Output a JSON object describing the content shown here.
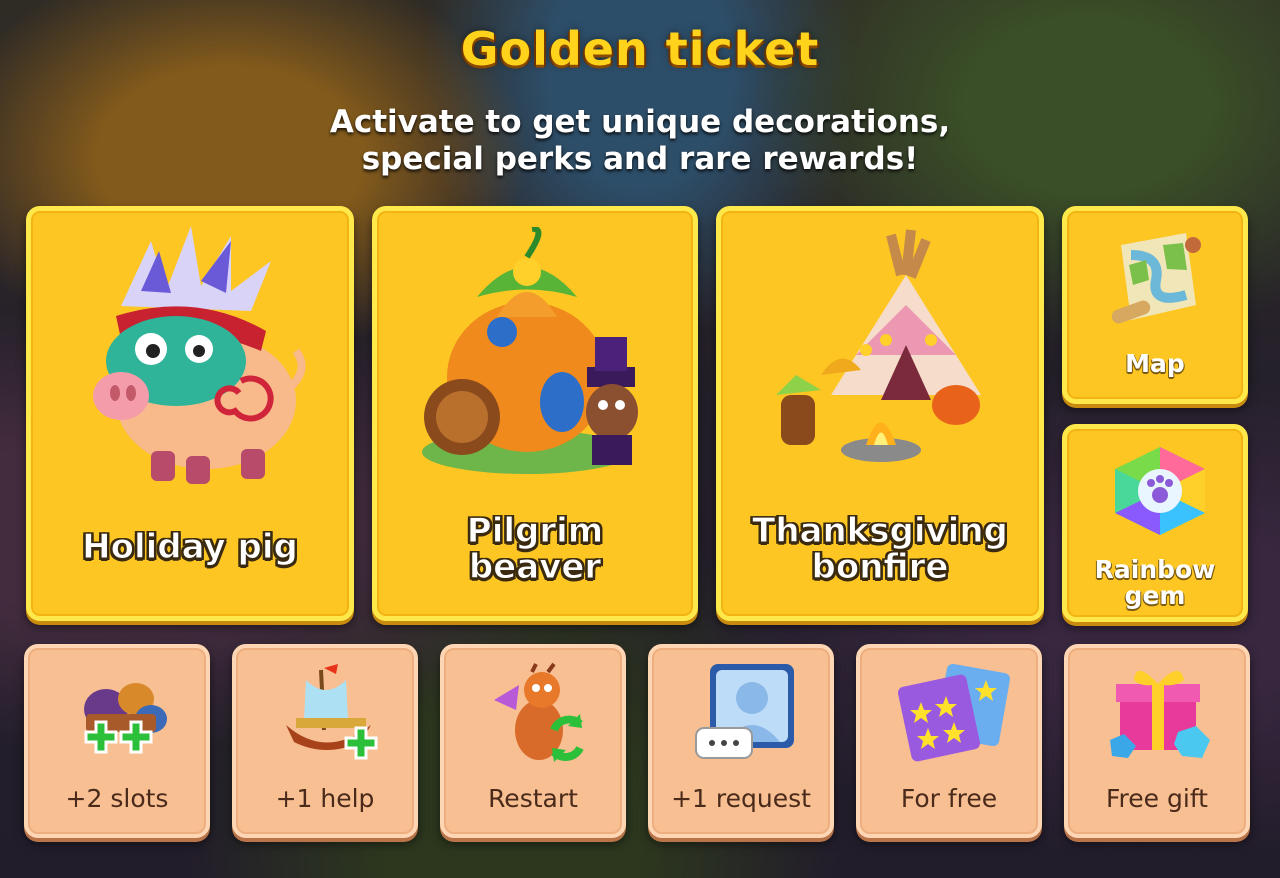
{
  "header": {
    "title": "Golden ticket",
    "subtitle": "Activate to get unique decorations,\nspecial perks and rare rewards!"
  },
  "rewards": [
    {
      "label": "Holiday pig",
      "icon": "holiday-pig-icon"
    },
    {
      "label": "Pilgrim\nbeaver",
      "icon": "pilgrim-beaver-icon"
    },
    {
      "label": "Thanksgiving\nbonfire",
      "icon": "thanksgiving-bonfire-icon"
    },
    {
      "label": "Map",
      "icon": "map-scroll-icon"
    },
    {
      "label": "Rainbow\ngem",
      "icon": "rainbow-gem-icon"
    }
  ],
  "perks": [
    {
      "label": "+2 slots",
      "icon": "slots-icon"
    },
    {
      "label": "+1 help",
      "icon": "ship-help-icon"
    },
    {
      "label": "Restart",
      "icon": "dragon-restart-icon"
    },
    {
      "label": "+1 request",
      "icon": "request-avatar-icon"
    },
    {
      "label": "For free",
      "icon": "star-cards-icon"
    },
    {
      "label": "Free gift",
      "icon": "gift-box-icon"
    }
  ],
  "colors": {
    "title": "#ffd21c",
    "reward_card": "#fdc623",
    "perk_tile": "#f8bf92"
  }
}
